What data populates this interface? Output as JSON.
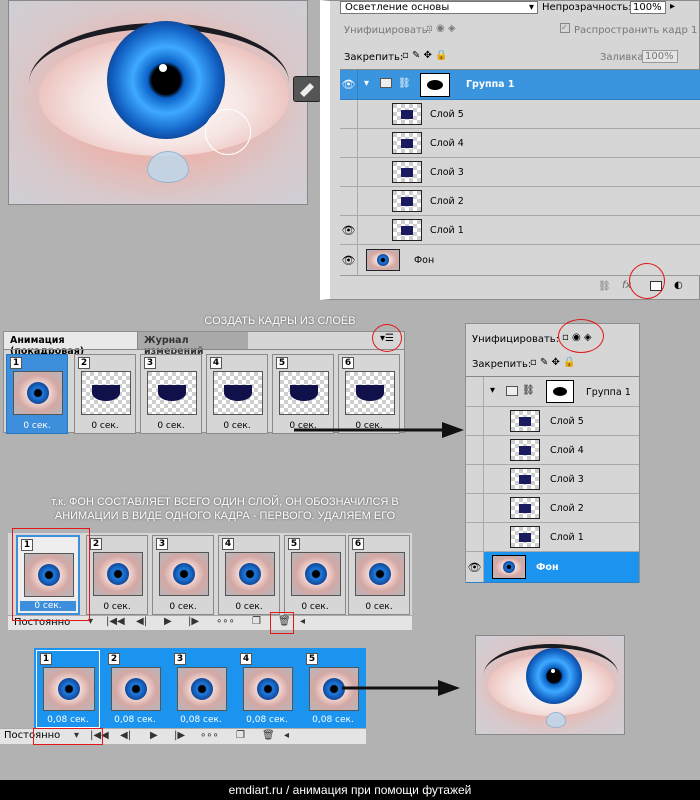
{
  "top_panel": {
    "blend_mode": "Осветление основы",
    "opacity_label": "Непрозрачность:",
    "opacity_value": "100%",
    "unify_label": "Унифицировать:",
    "propagate_label": "Распространить кадр 1",
    "lock_label": "Закрепить:",
    "fill_label": "Заливка:",
    "fill_value": "100%",
    "group": "Группа 1",
    "layers": [
      "Слой 5",
      "Слой 4",
      "Слой 3",
      "Слой 2",
      "Слой 1"
    ],
    "background": "Фон",
    "fx": "fx"
  },
  "animation_panel": {
    "tab_active": "Анимация (покадровая)",
    "tab_inactive": "Журнал измерений",
    "caption": "СОЗДАТЬ КАДРЫ ИЗ СЛОЁВ",
    "frames": [
      {
        "num": "1",
        "delay": "0 сек."
      },
      {
        "num": "2",
        "delay": "0 сек."
      },
      {
        "num": "3",
        "delay": "0 сек."
      },
      {
        "num": "4",
        "delay": "0 сек."
      },
      {
        "num": "5",
        "delay": "0 сек."
      },
      {
        "num": "6",
        "delay": "0 сек."
      }
    ]
  },
  "right_panel": {
    "unify_label": "Унифицировать:",
    "lock_label": "Закрепить:",
    "group": "Группа 1",
    "layers": [
      "Слой 5",
      "Слой 4",
      "Слой 3",
      "Слой 2",
      "Слой 1"
    ],
    "background": "Фон"
  },
  "middle_section": {
    "caption_line1": "т.к. ФОН СОСТАВЛЯЕТ ВСЕГО ОДИН СЛОЙ,  ОН ОБОЗНАЧИЛСЯ В",
    "caption_line2": "АНИМАЦИИ В ВИДЕ ОДНОГО КАДРА - ПЕРВОГО. УДАЛЯЕМ ЕГО",
    "frames": [
      {
        "num": "1",
        "delay": "0 сек."
      },
      {
        "num": "2",
        "delay": "0 сек."
      },
      {
        "num": "3",
        "delay": "0 сек."
      },
      {
        "num": "4",
        "delay": "0 сек."
      },
      {
        "num": "5",
        "delay": "0 сек."
      },
      {
        "num": "6",
        "delay": "0 сек."
      }
    ],
    "loop": "Постоянно"
  },
  "bottom_section": {
    "frames": [
      {
        "num": "1",
        "delay": "0,08 сек."
      },
      {
        "num": "2",
        "delay": "0,08 сек."
      },
      {
        "num": "3",
        "delay": "0,08 сек."
      },
      {
        "num": "4",
        "delay": "0,08 сек."
      },
      {
        "num": "5",
        "delay": "0,08 сек."
      }
    ],
    "loop": "Постоянно"
  },
  "footer": "emdiart.ru / анимация при помощи футажей",
  "colors": {
    "selection": "#3a95de",
    "highlight": "#e01818",
    "panel": "#d6d6d6"
  },
  "icons": [
    "eye-icon",
    "folder-icon",
    "chain-icon",
    "lock-icon",
    "brush-icon",
    "move-icon",
    "trash-icon",
    "play-icon",
    "menu-icon",
    "mask-icon",
    "adjustment-icon",
    "link-icon",
    "new-frame-icon",
    "tween-icon"
  ]
}
